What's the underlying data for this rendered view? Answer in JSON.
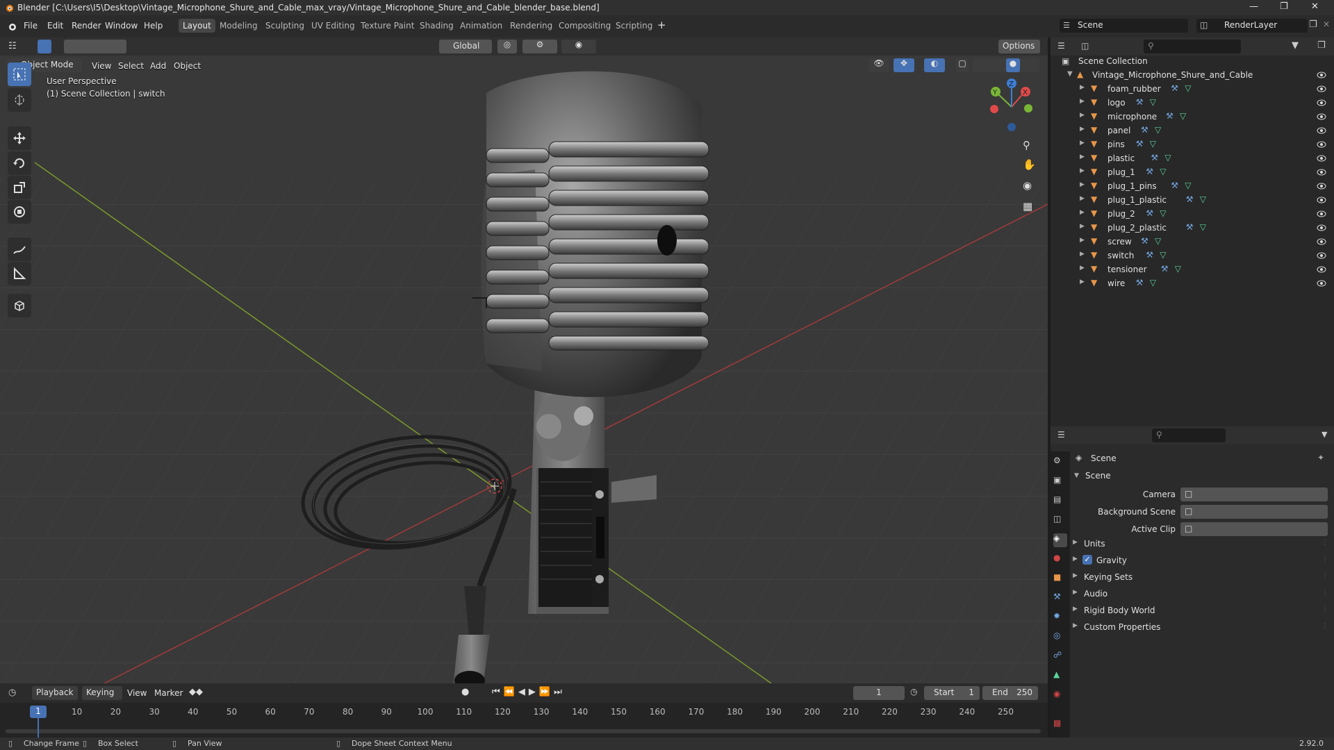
{
  "window": {
    "title": "Blender [C:\\Users\\I5\\Desktop\\Vintage_Microphone_Shure_and_Cable_max_vray/Vintage_Microphone_Shure_and_Cable_blender_base.blend]"
  },
  "menu": [
    "File",
    "Edit",
    "Render",
    "Window",
    "Help"
  ],
  "workspaces": [
    "Layout",
    "Modeling",
    "Sculpting",
    "UV Editing",
    "Texture Paint",
    "Shading",
    "Animation",
    "Rendering",
    "Compositing",
    "Scripting"
  ],
  "active_workspace": "Layout",
  "scene_selector": "Scene",
  "renderlayer_selector": "RenderLayer",
  "toolbar3d": {
    "transform_orientation": "Global",
    "options": "Options"
  },
  "header3d": {
    "mode": "Object Mode",
    "menus": [
      "View",
      "Select",
      "Add",
      "Object"
    ]
  },
  "viewport": {
    "perspective": "User Perspective",
    "collection_info": "(1) Scene Collection | switch",
    "gizmo_axes": [
      "X",
      "Y",
      "Z"
    ]
  },
  "outliner": {
    "root": "Scene Collection",
    "collection": "Vintage_Microphone_Shure_and_Cable",
    "objects": [
      "foam_rubber",
      "logo",
      "microphone",
      "panel",
      "pins",
      "plastic",
      "plug_1",
      "plug_1_pins",
      "plug_1_plastic",
      "plug_2",
      "plug_2_plastic",
      "screw",
      "switch",
      "tensioner",
      "wire"
    ]
  },
  "properties": {
    "header": "Scene",
    "panel": "Scene",
    "fields": [
      {
        "label": "Camera",
        "value": ""
      },
      {
        "label": "Background Scene",
        "value": ""
      },
      {
        "label": "Active Clip",
        "value": ""
      }
    ],
    "subpanels": [
      "Units",
      "Gravity",
      "Keying Sets",
      "Audio",
      "Rigid Body World",
      "Custom Properties"
    ],
    "gravity_checked": true
  },
  "timeline": {
    "menus": [
      "Playback",
      "Keying",
      "View",
      "Marker"
    ],
    "current_frame": "1",
    "start_label": "Start",
    "start": "1",
    "end_label": "End",
    "end": "250",
    "ticks": [
      "10",
      "20",
      "30",
      "40",
      "50",
      "60",
      "70",
      "80",
      "90",
      "100",
      "110",
      "120",
      "130",
      "140",
      "150",
      "160",
      "170",
      "180",
      "190",
      "200",
      "210",
      "220",
      "230",
      "240",
      "250"
    ],
    "playhead": "1"
  },
  "statusbar": {
    "items": [
      "Change Frame",
      "Box Select",
      "Pan View",
      "Dope Sheet Context Menu"
    ],
    "version": "2.92.0"
  },
  "colors": {
    "accent": "#4772b3",
    "object_icon": "#e8964a",
    "mesh_icon": "#5ad49b",
    "modifier_icon": "#74a6e0"
  }
}
